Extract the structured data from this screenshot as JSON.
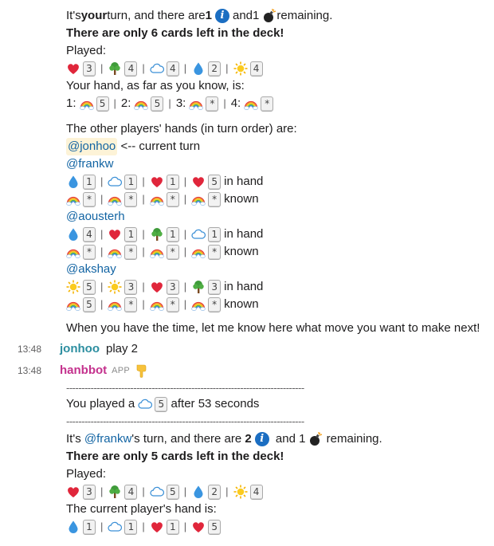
{
  "block1": {
    "turn_pre": "It's ",
    "turn_your": "your",
    "turn_mid": " turn, and there are ",
    "info_count": "1",
    "and": " and ",
    "fuse_count": "1",
    "remaining": " remaining.",
    "deck_msg": "There are only 6 cards left in the deck!",
    "played_label": "Played:",
    "played": [
      {
        "icon": "heart",
        "num": "3"
      },
      {
        "icon": "tree",
        "num": "4"
      },
      {
        "icon": "cloud",
        "num": "4"
      },
      {
        "icon": "drop",
        "num": "2"
      },
      {
        "icon": "sun",
        "num": "4"
      }
    ],
    "hand_label": "Your hand, as far as you know, is:",
    "hand": [
      {
        "idx": "1:",
        "icon": "rainbow",
        "num": "5"
      },
      {
        "idx": "2:",
        "icon": "rainbow",
        "num": "5"
      },
      {
        "idx": "3:",
        "icon": "rainbow",
        "num": "*"
      },
      {
        "idx": "4:",
        "icon": "rainbow",
        "num": "*"
      }
    ],
    "others_label": "The other players' hands (in turn order) are:",
    "current_player": "@jonhoo",
    "current_suffix": " <-- current turn",
    "in_hand": "in hand",
    "known": "known",
    "players": [
      {
        "name": "@frankw",
        "hand": [
          {
            "icon": "drop",
            "num": "1"
          },
          {
            "icon": "cloud",
            "num": "1"
          },
          {
            "icon": "heart",
            "num": "1"
          },
          {
            "icon": "heart",
            "num": "5"
          }
        ],
        "known": [
          {
            "icon": "rainbow",
            "num": "*"
          },
          {
            "icon": "rainbow",
            "num": "*"
          },
          {
            "icon": "rainbow",
            "num": "*"
          },
          {
            "icon": "rainbow",
            "num": "*"
          }
        ]
      },
      {
        "name": "@aousterh",
        "hand": [
          {
            "icon": "drop",
            "num": "4"
          },
          {
            "icon": "heart",
            "num": "1"
          },
          {
            "icon": "tree",
            "num": "1"
          },
          {
            "icon": "cloud",
            "num": "1"
          }
        ],
        "known": [
          {
            "icon": "rainbow",
            "num": "*"
          },
          {
            "icon": "rainbow",
            "num": "*"
          },
          {
            "icon": "rainbow",
            "num": "*"
          },
          {
            "icon": "rainbow",
            "num": "*"
          }
        ]
      },
      {
        "name": "@akshay",
        "hand": [
          {
            "icon": "sun",
            "num": "5"
          },
          {
            "icon": "sun",
            "num": "3"
          },
          {
            "icon": "heart",
            "num": "3"
          },
          {
            "icon": "tree",
            "num": "3"
          }
        ],
        "known": [
          {
            "icon": "rainbow",
            "num": "5"
          },
          {
            "icon": "rainbow",
            "num": "*"
          },
          {
            "icon": "rainbow",
            "num": "*"
          },
          {
            "icon": "rainbow",
            "num": "*"
          }
        ]
      }
    ],
    "closing": "When you have the time, let me know here what move you want to make next!"
  },
  "msg_jonhoo": {
    "time": "13:48",
    "sender": "jonhoo",
    "text": "play 2",
    "color": "#2c8ea0"
  },
  "msg_bot": {
    "time": "13:48",
    "sender": "hanbbot",
    "badge": "APP",
    "color": "#c4318d"
  },
  "dashes": "------------------------------------------------------------------------------",
  "block2": {
    "played_pre": "You played a ",
    "played_card": {
      "icon": "cloud",
      "num": "5"
    },
    "played_post": " after 53 seconds",
    "turn_pre": "It's ",
    "turn_player": "@frankw",
    "turn_mid": "'s turn, and there are ",
    "info_count": "2",
    "and": " and ",
    "fuse_count": "1",
    "remaining": " remaining.",
    "deck_msg": "There are only 5 cards left in the deck!",
    "played_label": "Played:",
    "played": [
      {
        "icon": "heart",
        "num": "3"
      },
      {
        "icon": "tree",
        "num": "4"
      },
      {
        "icon": "cloud",
        "num": "5"
      },
      {
        "icon": "drop",
        "num": "2"
      },
      {
        "icon": "sun",
        "num": "4"
      }
    ],
    "current_hand_label": "The current player's hand is:",
    "current_hand": [
      {
        "icon": "drop",
        "num": "1"
      },
      {
        "icon": "cloud",
        "num": "1"
      },
      {
        "icon": "heart",
        "num": "1"
      },
      {
        "icon": "heart",
        "num": "5"
      }
    ]
  }
}
